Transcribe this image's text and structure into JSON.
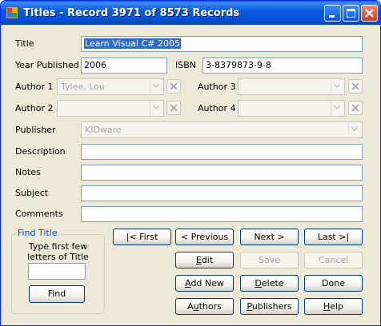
{
  "window": {
    "title": "Titles - Record 3971 of 8573 Records"
  },
  "fields": {
    "title": {
      "label": "Title",
      "value": "Learn Visual C# 2005"
    },
    "year": {
      "label": "Year Published",
      "value": "2006"
    },
    "isbn": {
      "label": "ISBN",
      "value": "3-8379873-9-8"
    },
    "author1": {
      "label": "Author 1",
      "value": "Tylee, Lou"
    },
    "author2": {
      "label": "Author 2",
      "value": ""
    },
    "author3": {
      "label": "Author 3",
      "value": ""
    },
    "author4": {
      "label": "Author 4",
      "value": ""
    },
    "publisher": {
      "label": "Publisher",
      "value": "KIDware"
    },
    "description": {
      "label": "Description",
      "value": ""
    },
    "notes": {
      "label": "Notes",
      "value": ""
    },
    "subject": {
      "label": "Subject",
      "value": ""
    },
    "comments": {
      "label": "Comments",
      "value": ""
    }
  },
  "find": {
    "group_title": "Find Title",
    "instructions_line1": "Type first few",
    "instructions_line2": "letters of Title",
    "input_value": "",
    "button": "Find"
  },
  "buttons": {
    "first": "|< First",
    "previous": "< Previous",
    "next": "Next >",
    "last": "Last >|",
    "edit_pre": "",
    "edit_u": "E",
    "edit_post": "dit",
    "save": "Save",
    "cancel": "Cancel",
    "addnew_pre": "",
    "addnew_u": "A",
    "addnew_post": "dd New",
    "delete_pre": "",
    "delete_u": "D",
    "delete_post": "elete",
    "done": "Done",
    "authors_pre": "A",
    "authors_u": "u",
    "authors_post": "thors",
    "publishers_pre": "",
    "publishers_u": "P",
    "publishers_post": "ublishers",
    "help_pre": "",
    "help_u": "H",
    "help_post": "elp"
  },
  "colors": {
    "titlebar": "#0a5be0",
    "selection": "#316ac5",
    "group_title": "#0046d5"
  }
}
